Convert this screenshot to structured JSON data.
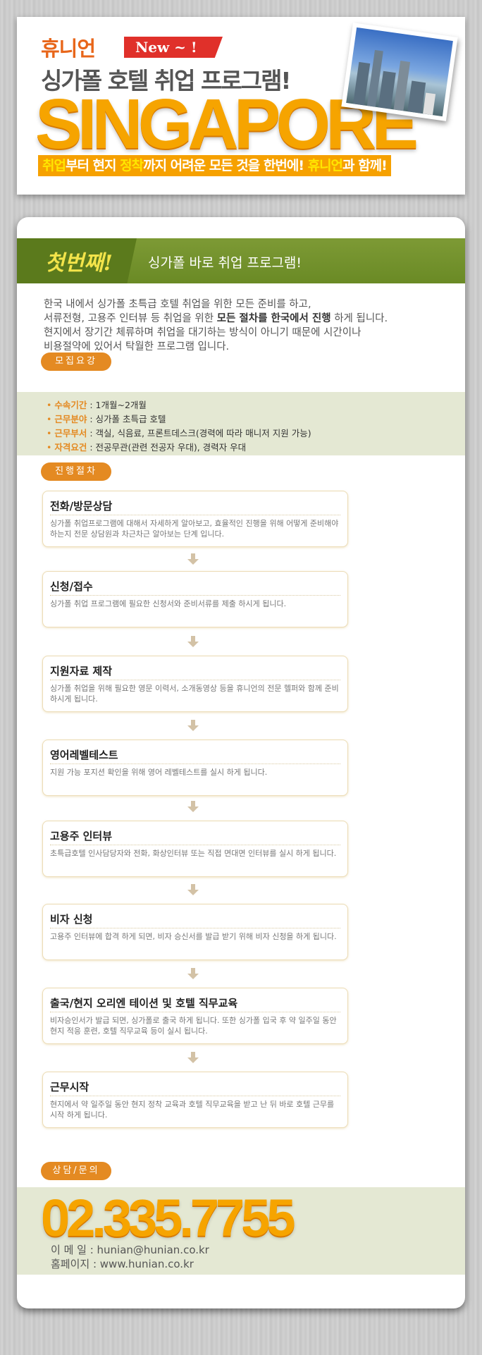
{
  "header": {
    "brand": "휴니언",
    "badge": "New ~ !",
    "title": "싱가폴 호텔 취업 프로그램!",
    "big_word": "SINGAPORE",
    "tagline": {
      "p1": "취업",
      "p2": "부터 현지 ",
      "p3": "정착",
      "p4": "까지 어려운 모든 것을 한번에! ",
      "p5": "휴니언",
      "p6": "과 함께!"
    }
  },
  "banner": {
    "step": "첫번째!",
    "text": "싱가폴 바로 취업 프로그램!"
  },
  "intro": {
    "line1": "한국 내에서 싱가폴 초특급 호텔 취업을 위한 모든 준비를 하고,",
    "line2a": "서류전형, 고용주 인터뷰 등 취업을 위한 ",
    "line2b": "모든 절차를 한국에서 진행",
    "line2c": " 하게 됩니다.",
    "line3": "현지에서 장기간 체류하며 취업을 대기하는 방식이 아니기  때문에 시간이나",
    "line4": "비용절약에 있어서 탁월한 프로그램 입니다."
  },
  "requirements": {
    "label": "모집요강",
    "items": [
      {
        "key": "수속기간",
        "value": " : 1개월~2개월"
      },
      {
        "key": "근무분야",
        "value": " : 싱가폴 초특급 호텔"
      },
      {
        "key": "근무부서",
        "value": " : 객실, 식음료, 프론트데스크(경력에 따라 매니저 지원 가능)"
      },
      {
        "key": "자격요건",
        "value": " : 전공무관(관련 전공자 우대), 경력자 우대"
      }
    ]
  },
  "process": {
    "label": "진행절차",
    "steps": [
      {
        "title": "전화/방문상담",
        "desc": "싱가폴 취업프로그램에 대해서 자세하게 알아보고, 효율적인 진행을 위해 어떻게 준비해야 하는지 전문 상담원과 차근차근 알아보는 단계 입니다."
      },
      {
        "title": "신청/접수",
        "desc": "싱가폴 취업 프로그램에 필요한 신청서와 준비서류를 제출 하시게 됩니다."
      },
      {
        "title": "지원자료 제작",
        "desc": "싱가폴 취업을 위해 필요한 영문 이력서, 소개동영상 등을 휴니언의 전문 헬퍼와 함께 준비 하시게 됩니다."
      },
      {
        "title": "영어레벨테스트",
        "desc": "지원 가능 포지션 확인을 위해 영어 레벨테스트를 실시 하게 됩니다."
      },
      {
        "title": "고용주 인터뷰",
        "desc": "초특급호텔 인사담당자와 전화, 화상인터뷰 또는 직접 면대면 인터뷰를 실시 하게 됩니다."
      },
      {
        "title": "비자 신청",
        "desc": "고용주 인터뷰에 합격 하게 되면, 비자 승신서를 발급 받기 위해 비자 신청을 하게 됩니다."
      },
      {
        "title": "출국/현지 오리엔 테이션 및 호텔 직무교육",
        "desc": "비자승인서가 발급 되면, 싱가폴로 출국 하게 됩니다. 또한 싱가폴 입국 후 약 일주일 동안 현지 적응 훈련, 호텔 직무교육 등이 실시 됩니다."
      },
      {
        "title": "근무시작",
        "desc": "현지에서 약 일주일 동안 현지 정착 교육과 호텔 직무교육을 받고 난 뒤 바로 호텔 근무를 시작 하게 됩니다."
      }
    ]
  },
  "contact": {
    "label": "상담/문의",
    "phone": "02.335.7755",
    "email": "이 메 일 : hunian@hunian.co.kr",
    "homepage": "홈페이지 : www.hunian.co.kr"
  },
  "colors": {
    "accent_orange": "#f6a400",
    "banner_green": "#6a8a25",
    "pill_orange": "#e48a22",
    "panel_green": "#e4e8d3"
  }
}
